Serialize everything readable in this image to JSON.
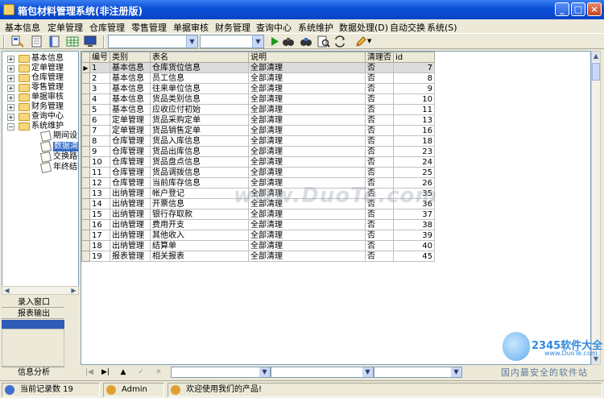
{
  "window": {
    "title": "箱包材料管理系统(非注册版)"
  },
  "menu": [
    "基本信息",
    "定单管理",
    "仓库管理",
    "零售管理",
    "单据审核",
    "财务管理",
    "查询中心",
    "系统维护",
    "数据处理(D)",
    "自动交换",
    "系统(S)"
  ],
  "tree": {
    "nodes": [
      "基本信息",
      "定单管理",
      "仓库管理",
      "零售管理",
      "单据审核",
      "财务管理",
      "查询中心",
      "系统维护"
    ],
    "children": [
      "期间设置",
      "数据清理",
      "交换路径",
      "年终结转"
    ],
    "selected_child": "数据清理"
  },
  "left_nav": {
    "entry_window": "录入窗口",
    "report_output": "报表输出",
    "info_analysis": "信息分析"
  },
  "grid": {
    "columns": [
      "编号",
      "类别",
      "表名",
      "说明",
      "清理否",
      "id"
    ],
    "rows": [
      [
        "1",
        "基本信息",
        "仓库货位信息",
        "全部清理",
        "否",
        "7"
      ],
      [
        "2",
        "基本信息",
        "员工信息",
        "全部清理",
        "否",
        "8"
      ],
      [
        "3",
        "基本信息",
        "往来单位信息",
        "全部清理",
        "否",
        "9"
      ],
      [
        "4",
        "基本信息",
        "货品类别信息",
        "全部清理",
        "否",
        "10"
      ],
      [
        "5",
        "基本信息",
        "应收应付初始",
        "全部清理",
        "否",
        "11"
      ],
      [
        "6",
        "定单管理",
        "货品采购定单",
        "全部清理",
        "否",
        "13"
      ],
      [
        "7",
        "定单管理",
        "货品销售定单",
        "全部清理",
        "否",
        "16"
      ],
      [
        "8",
        "仓库管理",
        "货品入库信息",
        "全部清理",
        "否",
        "18"
      ],
      [
        "9",
        "仓库管理",
        "货品出库信息",
        "全部清理",
        "否",
        "23"
      ],
      [
        "10",
        "仓库管理",
        "货品盘点信息",
        "全部清理",
        "否",
        "24"
      ],
      [
        "11",
        "仓库管理",
        "货品调拨信息",
        "全部清理",
        "否",
        "25"
      ],
      [
        "12",
        "仓库管理",
        "当前库存信息",
        "全部清理",
        "否",
        "26"
      ],
      [
        "13",
        "出纳管理",
        "帐户登记",
        "全部清理",
        "否",
        "35"
      ],
      [
        "14",
        "出纳管理",
        "开票信息",
        "全部清理",
        "否",
        "36"
      ],
      [
        "15",
        "出纳管理",
        "银行存取款",
        "全部清理",
        "否",
        "37"
      ],
      [
        "16",
        "出纳管理",
        "费用开支",
        "全部清理",
        "否",
        "38"
      ],
      [
        "17",
        "出纳管理",
        "其他收入",
        "全部清理",
        "否",
        "39"
      ],
      [
        "18",
        "出纳管理",
        "结算单",
        "全部清理",
        "否",
        "40"
      ],
      [
        "19",
        "报表管理",
        "相关报表",
        "全部清理",
        "否",
        "45"
      ]
    ],
    "current_row": 0
  },
  "status": {
    "record_count": "当前记录数 19",
    "user": "Admin",
    "welcome": "欢迎使用我们的产品!"
  },
  "watermark": {
    "center": "www.DuoTe.com",
    "brand": "2345软件大全",
    "site": "www.DuoTe.com",
    "slogan": "国内最安全的软件站"
  },
  "colors": {
    "titlebar": "#0a4fd8",
    "selection": "#316ac5",
    "nav_active": "#2f5bb7"
  }
}
